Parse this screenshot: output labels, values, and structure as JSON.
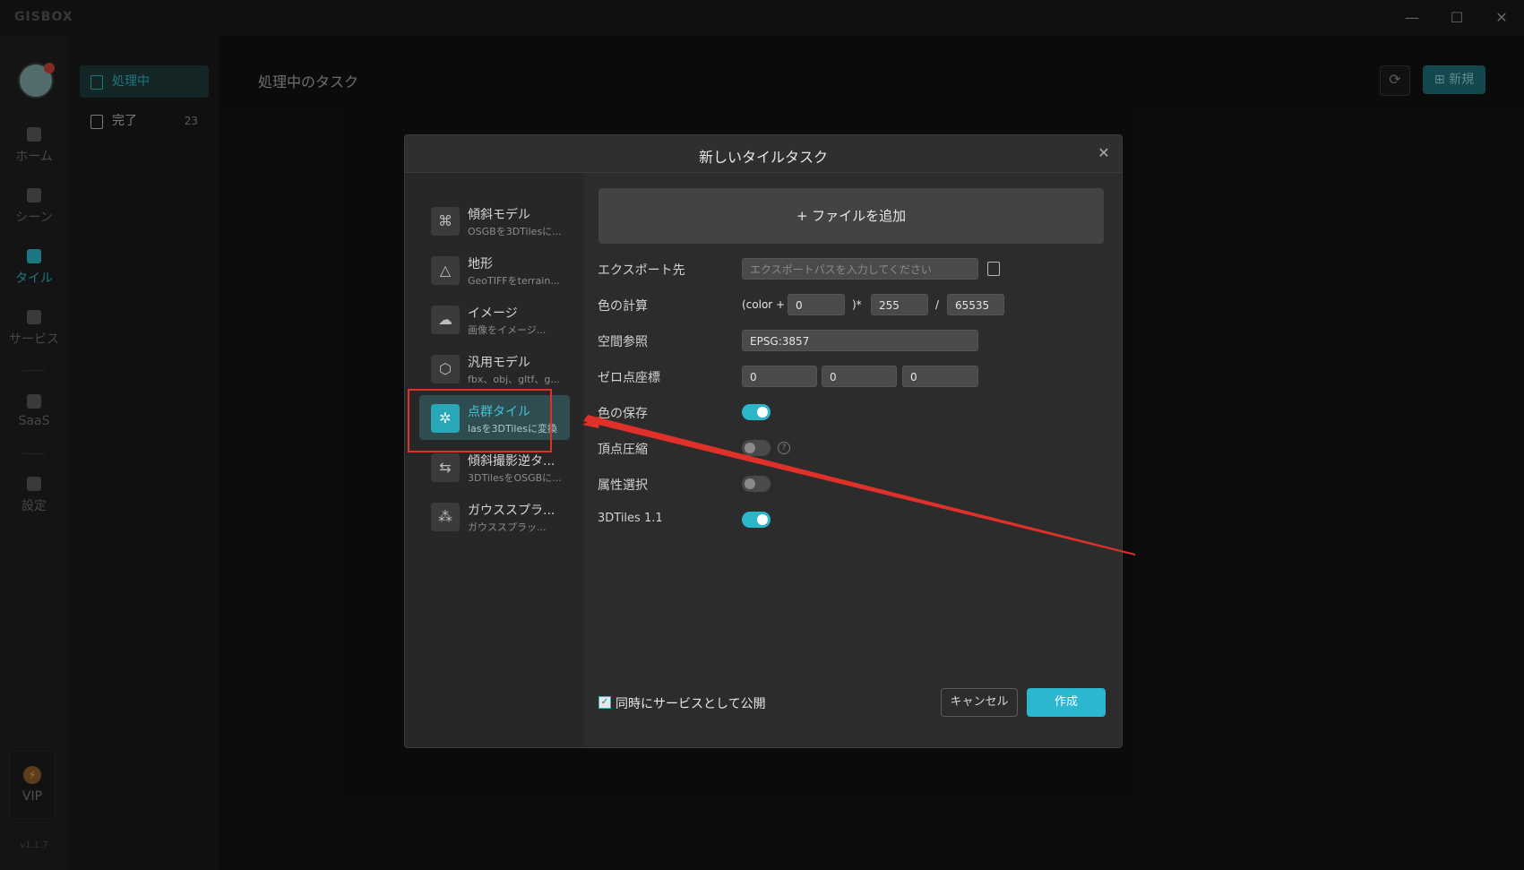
{
  "app": {
    "logo_text": "GISBOX"
  },
  "rail": {
    "items": [
      {
        "label": "ホーム"
      },
      {
        "label": "シーン"
      },
      {
        "label": "タイル"
      },
      {
        "label": "サービス"
      },
      {
        "label": "SaaS"
      },
      {
        "label": "設定"
      }
    ],
    "vip_label": "VIP",
    "version": "v1.1.7"
  },
  "subnav": {
    "items": [
      {
        "label": "処理中"
      },
      {
        "label": "完了",
        "count": "23"
      }
    ]
  },
  "main": {
    "title": "処理中のタスク",
    "new_button": "新規"
  },
  "dialog": {
    "title": "新しいタイルタスク",
    "tile_types": [
      {
        "name": "傾斜モデル",
        "desc": "OSGBを3DTilesに..."
      },
      {
        "name": "地形",
        "desc": "GeoTIFFをterrain..."
      },
      {
        "name": "イメージ",
        "desc": "画像をイメージ..."
      },
      {
        "name": "汎用モデル",
        "desc": "fbx、obj、gltf、g..."
      },
      {
        "name": "点群タイル",
        "desc": "lasを3DTilesに変換"
      },
      {
        "name": "傾斜撮影逆タ...",
        "desc": "3DTilesをOSGBに..."
      },
      {
        "name": "ガウススプラ...",
        "desc": "ガウススプラッ..."
      }
    ],
    "add_file": "+ ファイルを追加",
    "fields": {
      "export_label": "エクスポート先",
      "export_placeholder": "エクスポートパスを入力してください",
      "color_calc_label": "色の計算",
      "color_prefix": "(color +",
      "color_add": "0",
      "color_mul_op": ")*",
      "color_mul": "255",
      "color_div_op": "/",
      "color_div": "65535",
      "srs_label": "空間参照",
      "srs_value": "EPSG:3857",
      "origin_label": "ゼロ点座標",
      "origin_x": "0",
      "origin_y": "0",
      "origin_z": "0",
      "keep_color_label": "色の保存",
      "keep_color": true,
      "vertex_compress_label": "頂点圧縮",
      "vertex_compress": false,
      "attr_select_label": "属性選択",
      "attr_select": false,
      "tiles11_label": "3DTiles 1.1",
      "tiles11": true
    },
    "publish_label": "同時にサービスとして公開",
    "publish_checked": true,
    "cancel": "キャンセル",
    "create": "作成"
  },
  "colors": {
    "accent": "#2bb7c9",
    "highlight": "#e0302a"
  }
}
